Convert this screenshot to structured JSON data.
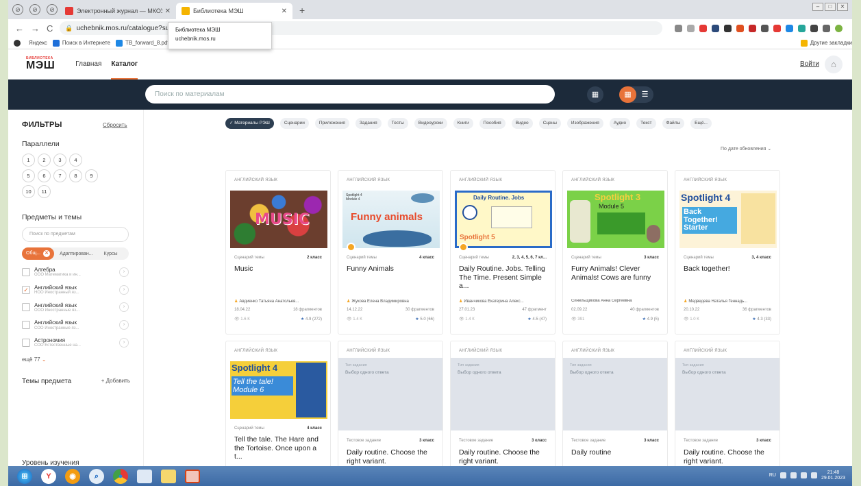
{
  "browser": {
    "tabs": [
      {
        "title": "Электронный журнал — МКОУ",
        "fav": "#e53935",
        "active": false
      },
      {
        "title": "Библиотека МЭШ",
        "fav": "#f5b400",
        "active": true
      }
    ],
    "url": "uchebnik.mos.ru/catalogue?subject",
    "tooltip": {
      "title": "Библиотека МЭШ",
      "domain": "uchebnik.mos.ru"
    },
    "bookmarks": [
      "Яндекс",
      "Поиск в Интернете",
      "TB_forward_8.pdf"
    ],
    "other_bookmarks": "Другие закладки"
  },
  "header": {
    "logo_small": "БИБЛИОТЕКА",
    "logo_big": "МЭШ",
    "nav": [
      "Главная",
      "Каталог"
    ],
    "login": "Войти"
  },
  "search": {
    "placeholder": "Поиск по материалам"
  },
  "sidebar": {
    "title": "ФИЛЬТРЫ",
    "reset": "Сбросить",
    "grades_title": "Параллели",
    "grades": [
      "1",
      "2",
      "3",
      "4",
      "5",
      "6",
      "7",
      "8",
      "9",
      "10",
      "11"
    ],
    "subjects_title": "Предметы и темы",
    "subject_search_placeholder": "Поиск по предметам",
    "subject_chips": [
      "Общ...",
      "Адаптирован...",
      "Курсы"
    ],
    "subjects": [
      {
        "name": "Алгебра",
        "desc": "ООО Математика и ин...",
        "checked": false
      },
      {
        "name": "Английский язык",
        "desc": "НОО Иностранный яз...",
        "checked": true
      },
      {
        "name": "Английский язык",
        "desc": "ООО Иностранные яз...",
        "checked": false
      },
      {
        "name": "Английский язык",
        "desc": "СОО Иностранные яз...",
        "checked": false
      },
      {
        "name": "Астрономия",
        "desc": "СОО Естественные на...",
        "checked": false
      }
    ],
    "more": "ещё 77",
    "topics_title": "Темы предмета",
    "topics_add": "+ Добавить",
    "level_title": "Уровень изучения"
  },
  "filters": [
    "Материалы РЭШ",
    "Сценарии",
    "Приложения",
    "Задания",
    "Тесты",
    "Видеоуроки",
    "Книги",
    "Пособия",
    "Видео",
    "Сцены",
    "Изображения",
    "Аудио",
    "Текст",
    "Файлы",
    "Ещё..."
  ],
  "sort": "По дате обновления",
  "cards": [
    {
      "subject": "АНГЛИЙСКИЙ ЯЗЫК",
      "type": "Сценарий темы",
      "grade": "2 класс",
      "title": "Music",
      "author": "Авдиенко Татьяна Анатольев...",
      "date": "18.04.22",
      "fragments": "18 фрагментов",
      "views": "1.6 К",
      "rating": "4.9 (272)",
      "image": "music"
    },
    {
      "subject": "АНГЛИЙСКИЙ ЯЗЫК",
      "type": "Сценарий темы",
      "grade": "4 класс",
      "title": "Funny Animals",
      "author": "Жукова Елена Владимировна",
      "date": "14.12.22",
      "fragments": "30 фрагментов",
      "views": "1.4 К",
      "rating": "5.0 (66)",
      "image": "funny",
      "img_text": "Funny animals",
      "img_caption": "Spotlight 4 Module 4"
    },
    {
      "subject": "АНГЛИЙСКИЙ ЯЗЫК",
      "type": "Сценарий темы",
      "grade": "2, 3, 4, 5, 6, 7 кл...",
      "title": "Daily Routine. Jobs. Telling The Time. Present Simple a...",
      "author": "Иванчикова Екатерина Алекс...",
      "date": "27.01.23",
      "fragments": "47 фрагмент",
      "views": "1.4 К",
      "rating": "4.5 (47)",
      "image": "daily",
      "img_text": "Daily Routine. Jobs",
      "img_caption": "Spotlight 5"
    },
    {
      "subject": "АНГЛИЙСКИЙ ЯЗЫК",
      "type": "Сценарий темы",
      "grade": "3 класс",
      "title": "Furry Animals! Clever Animals! Cows are funny",
      "author": "Синельщикова Анна Сергеевна",
      "date": "02.09.22",
      "fragments": "40 фрагментов",
      "views": "391",
      "rating": "4.9 (5)",
      "image": "furry",
      "img_text": "Spotlight 3",
      "img_caption": "Module 5"
    },
    {
      "subject": "АНГЛИЙСКИЙ ЯЗЫК",
      "type": "Сценарий темы",
      "grade": "3, 4 класс",
      "title": "Back together!",
      "author": "Медведева Наталья Геннадь...",
      "date": "20.10.22",
      "fragments": "36 фрагментов",
      "views": "1.0 К",
      "rating": "4.3 (33)",
      "image": "back",
      "img_text": "Spotlight 4",
      "img_caption": "Back Together! Starter"
    },
    {
      "subject": "АНГЛИЙСКИЙ ЯЗЫК",
      "type": "Сценарий темы",
      "grade": "4 класс",
      "title": "Tell the tale. The Hare and the Tortoise. Once upon a t...",
      "image": "tale",
      "img_text": "Spotlight 4",
      "img_caption": "Tell the tale! Module 6"
    },
    {
      "subject": "АНГЛИЙСКИЙ ЯЗЫК",
      "type": "Тестовое задание",
      "grade": "3 класс",
      "title": "Daily routine. Choose the right variant.",
      "ph1": "Тип задания",
      "ph2": "Выбор одного ответа"
    },
    {
      "subject": "АНГЛИЙСКИЙ ЯЗЫК",
      "type": "Тестовое задание",
      "grade": "3 класс",
      "title": "Daily routine. Choose the right variant.",
      "ph1": "Тип задания",
      "ph2": "Выбор одного ответа"
    },
    {
      "subject": "АНГЛИЙСКИЙ ЯЗЫК",
      "type": "Тестовое задание",
      "grade": "3 класс",
      "title": "Daily routine",
      "ph1": "Тип задания",
      "ph2": "Выбор одного ответа"
    },
    {
      "subject": "АНГЛИЙСКИЙ ЯЗЫК",
      "type": "Тестовое задание",
      "grade": "3 класс",
      "title": "Daily routine. Choose the right variant.",
      "ph1": "Тип задания",
      "ph2": "Выбор одного ответа"
    }
  ],
  "taskbar": {
    "lang": "RU",
    "time": "21:48",
    "date": "29.01.2023"
  },
  "colors": {
    "accent": "#e8733a",
    "dark": "#1c2a3a"
  }
}
